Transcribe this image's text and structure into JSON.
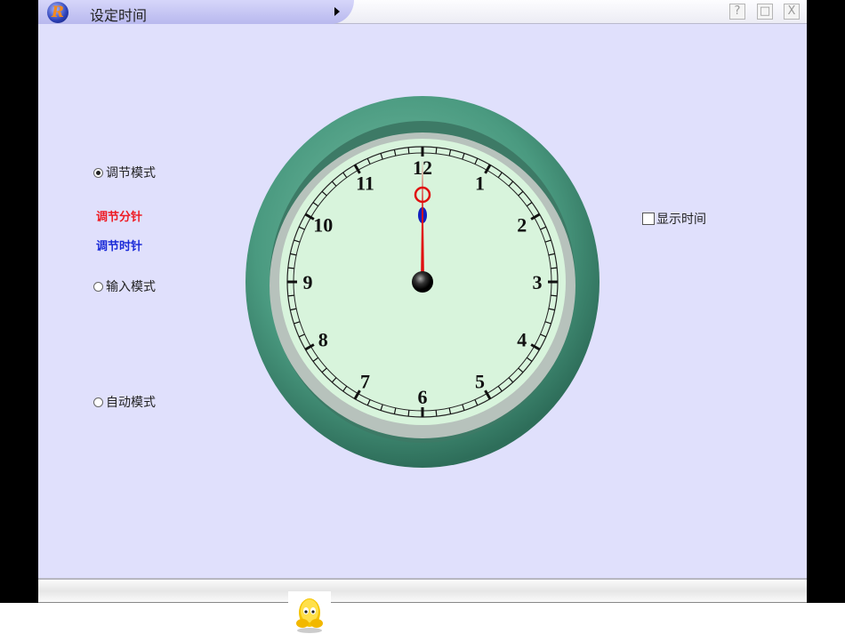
{
  "window": {
    "title": "设定时间",
    "help_label": "?",
    "restore_label": "□",
    "close_label": "X",
    "logo": "R"
  },
  "modes": [
    {
      "label": "调节模式",
      "selected": true
    },
    {
      "label": "输入模式",
      "selected": false
    },
    {
      "label": "自动模式",
      "selected": false
    }
  ],
  "adjust": {
    "minute_label": "调节分针",
    "hour_label": "调节时针",
    "minute_color": "#ee1c24",
    "hour_color": "#1c2cd8"
  },
  "show_time": {
    "label": "显示时间",
    "checked": false
  },
  "clock": {
    "numbers": [
      "12",
      "1",
      "2",
      "3",
      "4",
      "5",
      "6",
      "7",
      "8",
      "9",
      "10",
      "11"
    ],
    "hour": 12,
    "minute": 0,
    "minute_hand_color": "#e01010",
    "hour_hand_color": "#1020c0",
    "rim_color": "#3f9278",
    "face_color": "#d8f4dc"
  }
}
